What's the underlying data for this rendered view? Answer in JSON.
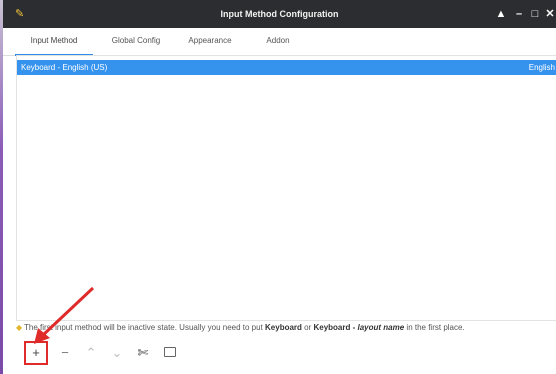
{
  "window": {
    "title": "Input Method Configuration",
    "app_icon": "keyboard-app-icon",
    "controls": {
      "keep_above": "▲",
      "minimize": "–",
      "maximize": "□",
      "close": "✕"
    }
  },
  "tabs": [
    {
      "label": "Input Method",
      "active": true
    },
    {
      "label": "Global Config",
      "active": false
    },
    {
      "label": "Appearance",
      "active": false
    },
    {
      "label": "Addon",
      "active": false
    }
  ],
  "input_methods": [
    {
      "name": "Keyboard - English (US)",
      "language": "English",
      "selected": true
    }
  ],
  "info": {
    "icon": "info-icon",
    "text_before": "The first input method will be inactive state. Usually you need to put ",
    "bold1": "Keyboard",
    "text_mid": " or ",
    "bold2": "Keyboard - ",
    "italic_bold": "layout name",
    "text_after": " in the first place."
  },
  "toolbar": {
    "add": "+",
    "remove": "−",
    "move_up": "⌃",
    "move_down": "⌄",
    "configure_icon": "tools-icon",
    "keyboard_layout_icon": "keyboard-layout-icon"
  },
  "colors": {
    "titlebar": "#2b2d30",
    "selection": "#3593ee",
    "tab_underline": "#2f8ce8",
    "highlight_box": "#e02b2b",
    "annotation_arrow": "#e02b2b"
  }
}
